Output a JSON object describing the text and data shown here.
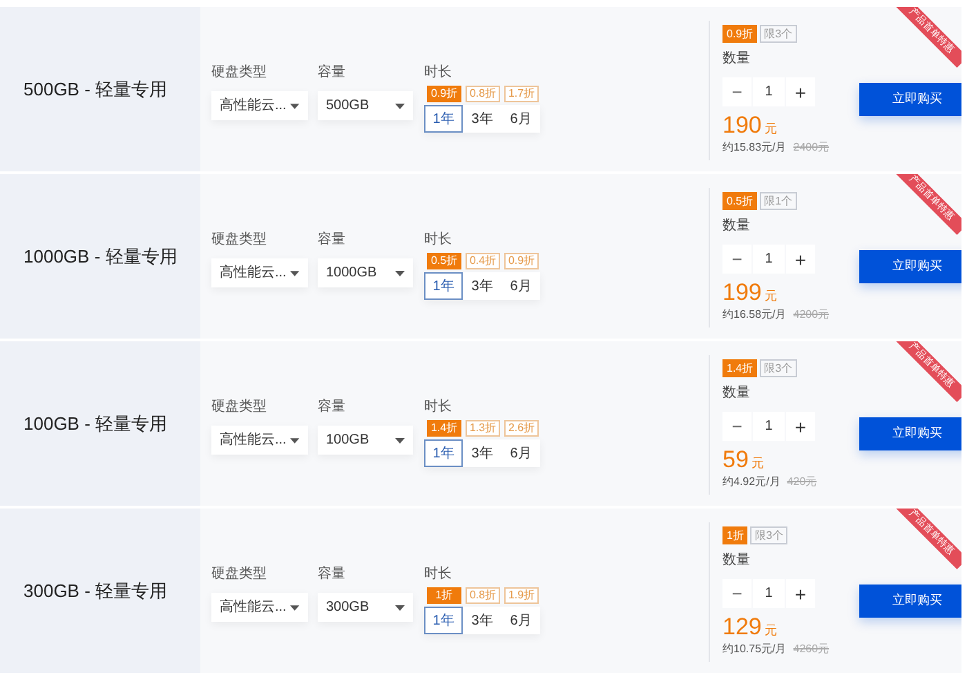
{
  "products": [
    {
      "title": "500GB - 轻量专用",
      "ribbon": "产品首单特惠",
      "disk_label": "硬盘类型",
      "disk_value": "高性能云...",
      "capacity_label": "容量",
      "capacity_value": "500GB",
      "duration_label": "时长",
      "durations": [
        {
          "discount": "0.9折",
          "label": "1年",
          "selected": true
        },
        {
          "discount": "0.8折",
          "label": "3年",
          "selected": false
        },
        {
          "discount": "1.7折",
          "label": "6月",
          "selected": false
        }
      ],
      "discount": "0.9折",
      "limit": "限3个",
      "quantity_label": "数量",
      "quantity": "1",
      "minus": "−",
      "plus": "+",
      "price": "190",
      "unit": "元",
      "monthly": "约15.83元/月",
      "original": "2400元",
      "buy": "立即购买"
    },
    {
      "title": "1000GB - 轻量专用",
      "ribbon": "产品首单特惠",
      "disk_label": "硬盘类型",
      "disk_value": "高性能云...",
      "capacity_label": "容量",
      "capacity_value": "1000GB",
      "duration_label": "时长",
      "durations": [
        {
          "discount": "0.5折",
          "label": "1年",
          "selected": true
        },
        {
          "discount": "0.4折",
          "label": "3年",
          "selected": false
        },
        {
          "discount": "0.9折",
          "label": "6月",
          "selected": false
        }
      ],
      "discount": "0.5折",
      "limit": "限1个",
      "quantity_label": "数量",
      "quantity": "1",
      "minus": "−",
      "plus": "+",
      "price": "199",
      "unit": "元",
      "monthly": "约16.58元/月",
      "original": "4200元",
      "buy": "立即购买"
    },
    {
      "title": "100GB - 轻量专用",
      "ribbon": "产品首单特惠",
      "disk_label": "硬盘类型",
      "disk_value": "高性能云...",
      "capacity_label": "容量",
      "capacity_value": "100GB",
      "duration_label": "时长",
      "durations": [
        {
          "discount": "1.4折",
          "label": "1年",
          "selected": true
        },
        {
          "discount": "1.3折",
          "label": "3年",
          "selected": false
        },
        {
          "discount": "2.6折",
          "label": "6月",
          "selected": false
        }
      ],
      "discount": "1.4折",
      "limit": "限3个",
      "quantity_label": "数量",
      "quantity": "1",
      "minus": "−",
      "plus": "+",
      "price": "59",
      "unit": "元",
      "monthly": "约4.92元/月",
      "original": "420元",
      "buy": "立即购买"
    },
    {
      "title": "300GB - 轻量专用",
      "ribbon": "产品首单特惠",
      "disk_label": "硬盘类型",
      "disk_value": "高性能云...",
      "capacity_label": "容量",
      "capacity_value": "300GB",
      "duration_label": "时长",
      "durations": [
        {
          "discount": "1折",
          "label": "1年",
          "selected": true
        },
        {
          "discount": "0.8折",
          "label": "3年",
          "selected": false
        },
        {
          "discount": "1.9折",
          "label": "6月",
          "selected": false
        }
      ],
      "discount": "1折",
      "limit": "限3个",
      "quantity_label": "数量",
      "quantity": "1",
      "minus": "−",
      "plus": "+",
      "price": "129",
      "unit": "元",
      "monthly": "约10.75元/月",
      "original": "4260元",
      "buy": "立即购买"
    }
  ]
}
